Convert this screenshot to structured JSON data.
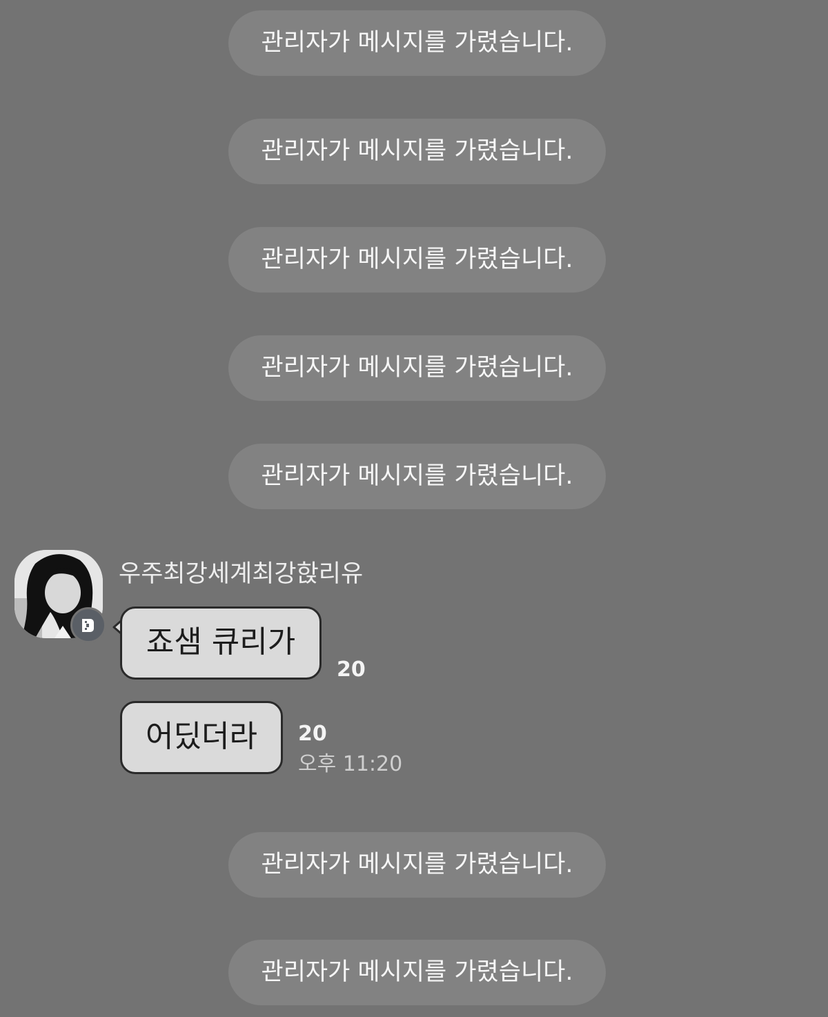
{
  "notices": [
    "관리자가 메시지를 가렸습니다.",
    "관리자가 메시지를 가렸습니다.",
    "관리자가 메시지를 가렸습니다.",
    "관리자가 메시지를 가렸습니다.",
    "관리자가 메시지를 가렸습니다.",
    "관리자가 메시지를 가렸습니다.",
    "관리자가 메시지를 가렸습니다."
  ],
  "message_group": {
    "sender_name": "우주최강세계최강핝리유",
    "badge_icon": "host-crown-icon",
    "messages": [
      {
        "text": "죠샘 큐리가",
        "unread": "20"
      },
      {
        "text": "어딨더라",
        "unread": "20",
        "time": "오후 11:20"
      }
    ]
  },
  "colors": {
    "background": "#737373",
    "notice_pill": "#828282",
    "bubble": "#dadada"
  }
}
